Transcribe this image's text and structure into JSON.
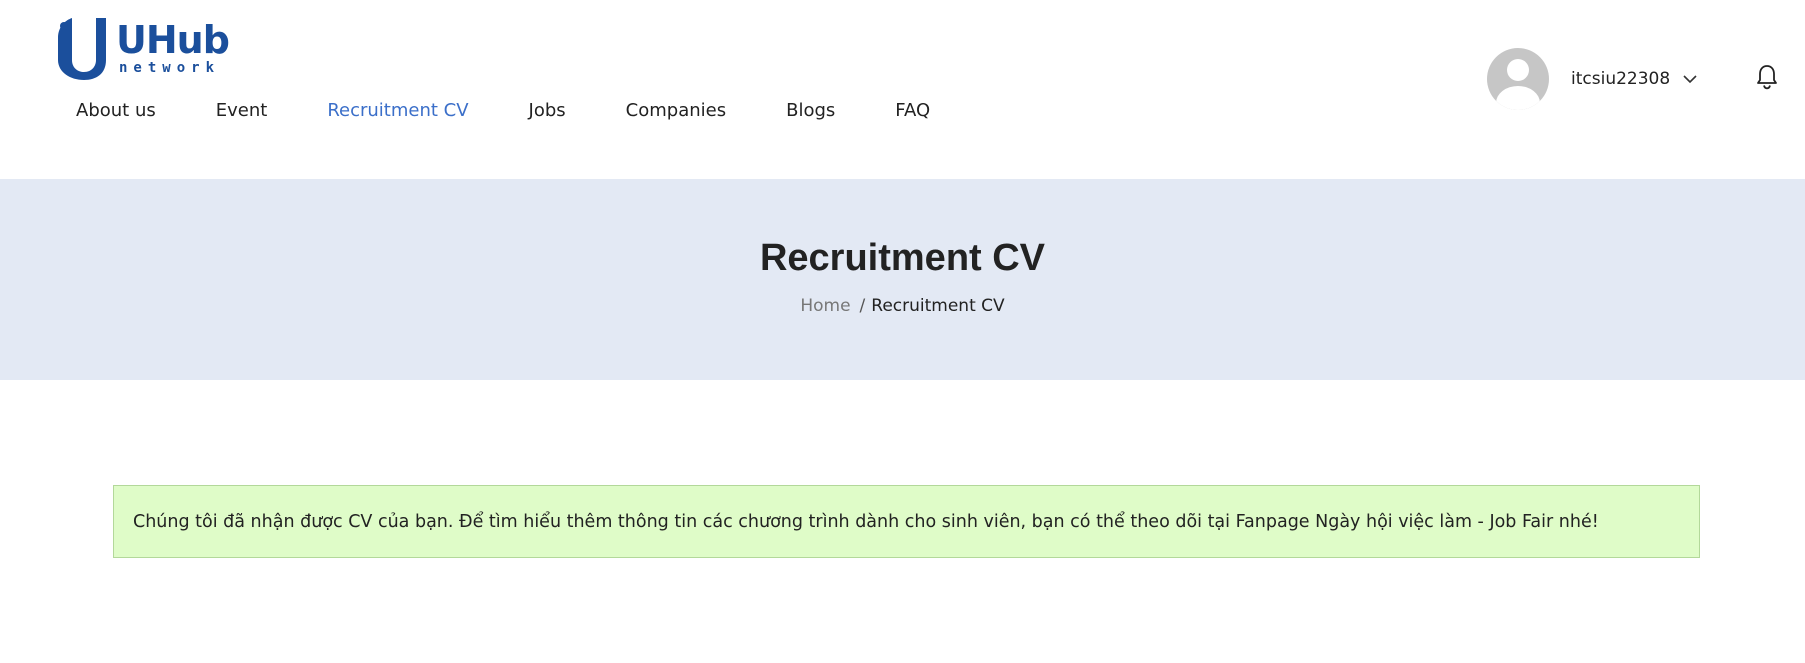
{
  "brand": {
    "name": "UHub",
    "tagline": "network",
    "color": "#1b4f9c"
  },
  "nav": {
    "items": [
      {
        "label": "About us",
        "active": false
      },
      {
        "label": "Event",
        "active": false
      },
      {
        "label": "Recruitment CV",
        "active": true
      },
      {
        "label": "Jobs",
        "active": false
      },
      {
        "label": "Companies",
        "active": false
      },
      {
        "label": "Blogs",
        "active": false
      },
      {
        "label": "FAQ",
        "active": false
      }
    ],
    "active_color": "#3b6fc9"
  },
  "user": {
    "username": "itcsiu22308",
    "avatar_icon": "default-user-avatar-icon",
    "menu_icon": "chevron-down-icon",
    "notification_icon": "bell-icon"
  },
  "banner": {
    "title": "Recruitment CV",
    "breadcrumb": {
      "home": "Home",
      "separator": "/",
      "current": "Recruitment CV"
    },
    "background": "#e3e9f4"
  },
  "alert": {
    "message": "Chúng tôi đã nhận được CV của bạn. Để tìm hiểu thêm thông tin các chương trình dành cho sinh viên, bạn có thể theo dõi tại Fanpage Ngày hội việc làm - Job Fair nhé!",
    "background": "#dffcc8",
    "border": "#b3d89a"
  }
}
